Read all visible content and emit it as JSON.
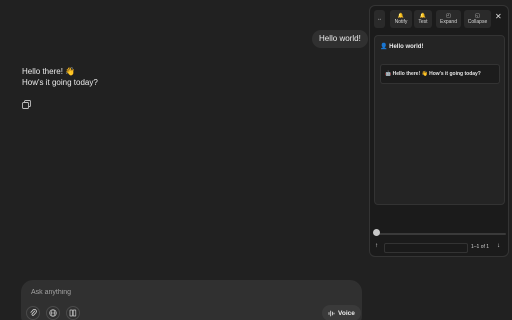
{
  "chat": {
    "user_message": "Hello world!",
    "assistant_line1": "Hello there! 👋",
    "assistant_line2": "How's it going today?"
  },
  "composer": {
    "placeholder": "Ask anything",
    "voice_label": "Voice",
    "tools": [
      "attach-icon",
      "globe-icon",
      "book-icon"
    ]
  },
  "panel": {
    "toolbar": {
      "notify_label": "Notify",
      "test_label": "Test",
      "expand_label": "Expand",
      "collapse_label": "Collapse"
    },
    "item": {
      "title": "👤 Hello world!",
      "reply": "🤖 Hello there! 👋 How's it going today?"
    },
    "pagination": {
      "count": "1–1 of 1"
    },
    "slider_value": 0
  },
  "colors": {
    "background": "#212121",
    "panel_background": "#1b1b1b",
    "bubble": "#303030"
  }
}
